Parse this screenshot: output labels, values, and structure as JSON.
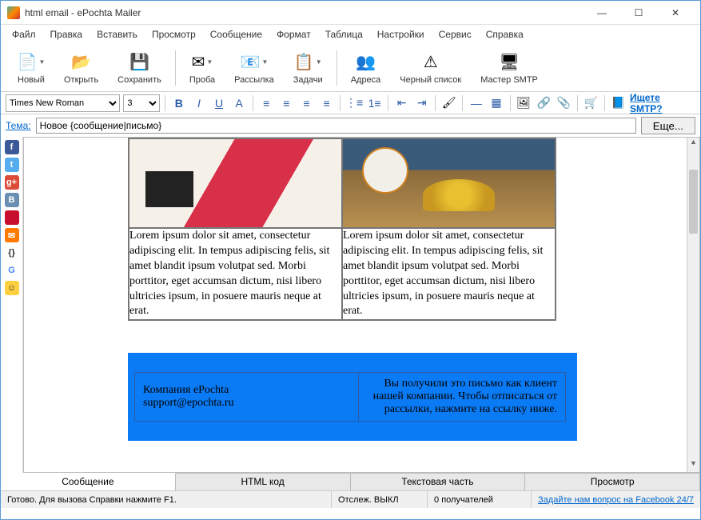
{
  "window": {
    "title": "html email - ePochta Mailer"
  },
  "menu": [
    "Файл",
    "Правка",
    "Вставить",
    "Просмотр",
    "Сообщение",
    "Формат",
    "Таблица",
    "Настройки",
    "Сервис",
    "Справка"
  ],
  "ribbon": [
    {
      "label": "Новый",
      "icon": "📄",
      "drop": true
    },
    {
      "label": "Открыть",
      "icon": "📂"
    },
    {
      "label": "Сохранить",
      "icon": "💾"
    },
    {
      "sep": true
    },
    {
      "label": "Проба",
      "icon": "✉",
      "drop": true
    },
    {
      "label": "Рассылка",
      "icon": "📧",
      "drop": true
    },
    {
      "label": "Задачи",
      "icon": "📋",
      "drop": true
    },
    {
      "sep": true
    },
    {
      "label": "Адреса",
      "icon": "👥"
    },
    {
      "label": "Черный список",
      "icon": "⚠"
    },
    {
      "label": "Мастер SMTP",
      "icon": "🖥"
    }
  ],
  "format": {
    "font": "Times New Roman",
    "size": "3",
    "smtp_link": "Ищете SMTP?"
  },
  "subject": {
    "label": "Тема:",
    "value": "Новое {сообщение|письмо}",
    "more": "Еще..."
  },
  "sidebar": [
    {
      "name": "facebook-icon",
      "bg": "#3b5998",
      "t": "f"
    },
    {
      "name": "twitter-icon",
      "bg": "#55acee",
      "t": "t"
    },
    {
      "name": "gplus-icon",
      "bg": "#dd4b39",
      "t": "g+"
    },
    {
      "name": "vk-icon",
      "bg": "#6b8fb3",
      "t": "В"
    },
    {
      "name": "linkedin-icon",
      "bg": "#c8102e",
      "t": ""
    },
    {
      "name": "mail-icon",
      "bg": "#ff7a00",
      "t": "✉"
    },
    {
      "name": "code-icon",
      "bg": "#fff",
      "t": "{}",
      "fg": "#333"
    },
    {
      "name": "google-icon",
      "bg": "#fff",
      "t": "G",
      "fg": "#4285f4"
    },
    {
      "name": "smile-icon",
      "bg": "#ffd040",
      "t": "☺",
      "fg": "#333"
    }
  ],
  "body": {
    "lorem": "Lorem ipsum dolor sit amet, consectetur adipiscing elit. In tempus adipiscing felis, sit amet blandit ipsum volutpat sed. Morbi porttitor, eget accumsan dictum, nisi libero ultricies ipsum, in posuere mauris neque at erat.",
    "footer_left": "Компания ePochta\nsupport@epochta.ru",
    "footer_right": "Вы получили это письмо как клиент нашей компании. Чтобы отписаться от рассылки, нажмите на ссылку ниже."
  },
  "tabs": [
    "Сообщение",
    "HTML код",
    "Текстовая часть",
    "Просмотр"
  ],
  "status": {
    "ready": "Готово. Для вызова Справки нажмите F1.",
    "track": "Отслеж. ВЫКЛ",
    "recip": "0 получателей",
    "fb": "Задайте нам вопрос на Facebook 24/7"
  }
}
